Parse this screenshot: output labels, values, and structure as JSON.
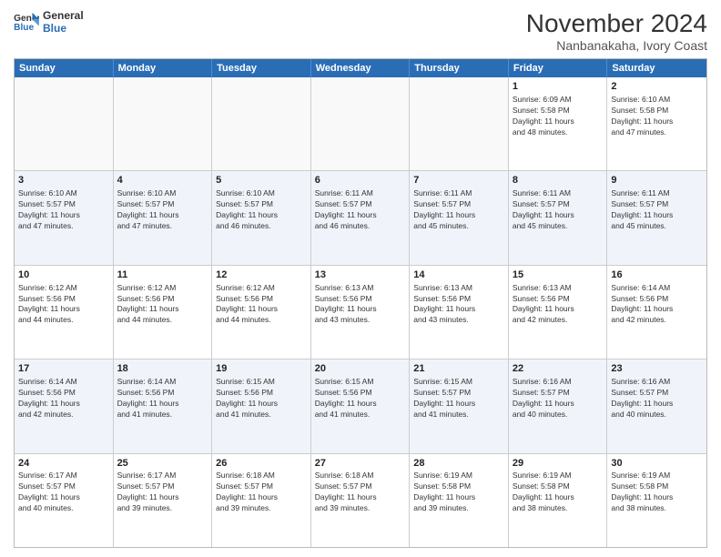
{
  "logo": {
    "line1": "General",
    "line2": "Blue"
  },
  "title": "November 2024",
  "subtitle": "Nanbanakaha, Ivory Coast",
  "days_of_week": [
    "Sunday",
    "Monday",
    "Tuesday",
    "Wednesday",
    "Thursday",
    "Friday",
    "Saturday"
  ],
  "rows": [
    [
      {
        "day": "",
        "info": "",
        "empty": true
      },
      {
        "day": "",
        "info": "",
        "empty": true
      },
      {
        "day": "",
        "info": "",
        "empty": true
      },
      {
        "day": "",
        "info": "",
        "empty": true
      },
      {
        "day": "",
        "info": "",
        "empty": true
      },
      {
        "day": "1",
        "info": "Sunrise: 6:09 AM\nSunset: 5:58 PM\nDaylight: 11 hours\nand 48 minutes."
      },
      {
        "day": "2",
        "info": "Sunrise: 6:10 AM\nSunset: 5:58 PM\nDaylight: 11 hours\nand 47 minutes."
      }
    ],
    [
      {
        "day": "3",
        "info": "Sunrise: 6:10 AM\nSunset: 5:57 PM\nDaylight: 11 hours\nand 47 minutes."
      },
      {
        "day": "4",
        "info": "Sunrise: 6:10 AM\nSunset: 5:57 PM\nDaylight: 11 hours\nand 47 minutes."
      },
      {
        "day": "5",
        "info": "Sunrise: 6:10 AM\nSunset: 5:57 PM\nDaylight: 11 hours\nand 46 minutes."
      },
      {
        "day": "6",
        "info": "Sunrise: 6:11 AM\nSunset: 5:57 PM\nDaylight: 11 hours\nand 46 minutes."
      },
      {
        "day": "7",
        "info": "Sunrise: 6:11 AM\nSunset: 5:57 PM\nDaylight: 11 hours\nand 45 minutes."
      },
      {
        "day": "8",
        "info": "Sunrise: 6:11 AM\nSunset: 5:57 PM\nDaylight: 11 hours\nand 45 minutes."
      },
      {
        "day": "9",
        "info": "Sunrise: 6:11 AM\nSunset: 5:57 PM\nDaylight: 11 hours\nand 45 minutes."
      }
    ],
    [
      {
        "day": "10",
        "info": "Sunrise: 6:12 AM\nSunset: 5:56 PM\nDaylight: 11 hours\nand 44 minutes."
      },
      {
        "day": "11",
        "info": "Sunrise: 6:12 AM\nSunset: 5:56 PM\nDaylight: 11 hours\nand 44 minutes."
      },
      {
        "day": "12",
        "info": "Sunrise: 6:12 AM\nSunset: 5:56 PM\nDaylight: 11 hours\nand 44 minutes."
      },
      {
        "day": "13",
        "info": "Sunrise: 6:13 AM\nSunset: 5:56 PM\nDaylight: 11 hours\nand 43 minutes."
      },
      {
        "day": "14",
        "info": "Sunrise: 6:13 AM\nSunset: 5:56 PM\nDaylight: 11 hours\nand 43 minutes."
      },
      {
        "day": "15",
        "info": "Sunrise: 6:13 AM\nSunset: 5:56 PM\nDaylight: 11 hours\nand 42 minutes."
      },
      {
        "day": "16",
        "info": "Sunrise: 6:14 AM\nSunset: 5:56 PM\nDaylight: 11 hours\nand 42 minutes."
      }
    ],
    [
      {
        "day": "17",
        "info": "Sunrise: 6:14 AM\nSunset: 5:56 PM\nDaylight: 11 hours\nand 42 minutes."
      },
      {
        "day": "18",
        "info": "Sunrise: 6:14 AM\nSunset: 5:56 PM\nDaylight: 11 hours\nand 41 minutes."
      },
      {
        "day": "19",
        "info": "Sunrise: 6:15 AM\nSunset: 5:56 PM\nDaylight: 11 hours\nand 41 minutes."
      },
      {
        "day": "20",
        "info": "Sunrise: 6:15 AM\nSunset: 5:56 PM\nDaylight: 11 hours\nand 41 minutes."
      },
      {
        "day": "21",
        "info": "Sunrise: 6:15 AM\nSunset: 5:57 PM\nDaylight: 11 hours\nand 41 minutes."
      },
      {
        "day": "22",
        "info": "Sunrise: 6:16 AM\nSunset: 5:57 PM\nDaylight: 11 hours\nand 40 minutes."
      },
      {
        "day": "23",
        "info": "Sunrise: 6:16 AM\nSunset: 5:57 PM\nDaylight: 11 hours\nand 40 minutes."
      }
    ],
    [
      {
        "day": "24",
        "info": "Sunrise: 6:17 AM\nSunset: 5:57 PM\nDaylight: 11 hours\nand 40 minutes."
      },
      {
        "day": "25",
        "info": "Sunrise: 6:17 AM\nSunset: 5:57 PM\nDaylight: 11 hours\nand 39 minutes."
      },
      {
        "day": "26",
        "info": "Sunrise: 6:18 AM\nSunset: 5:57 PM\nDaylight: 11 hours\nand 39 minutes."
      },
      {
        "day": "27",
        "info": "Sunrise: 6:18 AM\nSunset: 5:57 PM\nDaylight: 11 hours\nand 39 minutes."
      },
      {
        "day": "28",
        "info": "Sunrise: 6:19 AM\nSunset: 5:58 PM\nDaylight: 11 hours\nand 39 minutes."
      },
      {
        "day": "29",
        "info": "Sunrise: 6:19 AM\nSunset: 5:58 PM\nDaylight: 11 hours\nand 38 minutes."
      },
      {
        "day": "30",
        "info": "Sunrise: 6:19 AM\nSunset: 5:58 PM\nDaylight: 11 hours\nand 38 minutes."
      }
    ]
  ]
}
